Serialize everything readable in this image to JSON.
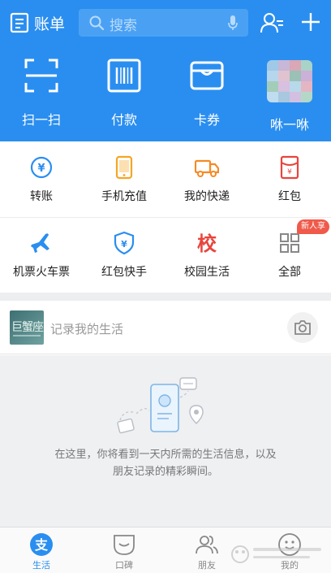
{
  "header": {
    "bill_label": "账单",
    "search_placeholder": "搜索",
    "brand_color": "#2a8ef0",
    "quick_actions": [
      {
        "label": "扫一扫",
        "icon": "scan-icon"
      },
      {
        "label": "付款",
        "icon": "barcode-icon"
      },
      {
        "label": "卡券",
        "icon": "card-wallet-icon"
      },
      {
        "label": "咻一咻",
        "icon": "blurred-avatar"
      }
    ]
  },
  "grid": {
    "items": [
      {
        "label": "转账",
        "icon": "transfer-icon",
        "color": "#2a8ef0"
      },
      {
        "label": "手机充值",
        "icon": "phone-recharge-icon",
        "color": "#f5a623"
      },
      {
        "label": "我的快递",
        "icon": "delivery-truck-icon",
        "color": "#f58a23"
      },
      {
        "label": "红包",
        "icon": "red-packet-icon",
        "color": "#e8453c"
      },
      {
        "label": "机票火车票",
        "icon": "airplane-icon",
        "color": "#2a8ef0"
      },
      {
        "label": "红包快手",
        "icon": "shield-yen-icon",
        "color": "#2a8ef0"
      },
      {
        "label": "校园生活",
        "icon": "campus-icon",
        "glyph": "校",
        "color": "#e8453c"
      },
      {
        "label": "全部",
        "icon": "grid-all-icon",
        "color": "#888888"
      }
    ],
    "new_badge": "新人享"
  },
  "life": {
    "avatar_text": "巨蟹座",
    "label": "记录我的生活"
  },
  "feed": {
    "empty_text": "在这里，你将看到一天内所需的生活信息，以及朋友记录的精彩瞬间。"
  },
  "tabbar": {
    "tabs": [
      {
        "label": "生活",
        "icon": "life-icon",
        "active": true,
        "glyph": "支"
      },
      {
        "label": "口碑",
        "icon": "koubei-icon",
        "active": false
      },
      {
        "label": "朋友",
        "icon": "friends-icon",
        "active": false
      },
      {
        "label": "我的",
        "icon": "profile-icon",
        "active": false
      }
    ]
  }
}
